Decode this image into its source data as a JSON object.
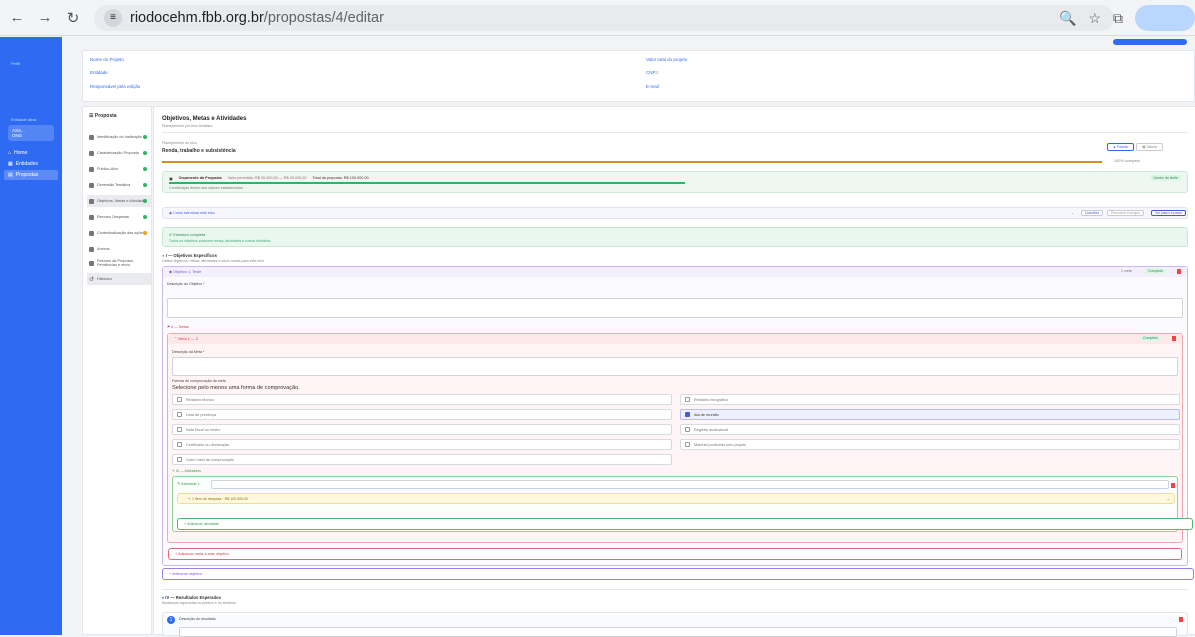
{
  "browser": {
    "url_host": "riodocehm.fbb.org.br",
    "url_path": "/propostas/4/editar"
  },
  "sidebar": {
    "section_label": "Perfil",
    "entity_label": "Entidade ativa",
    "entity_name": "ASS...",
    "entity_sub": "ONG",
    "items": [
      {
        "label": "Home"
      },
      {
        "label": "Entidades"
      },
      {
        "label": "Propostas"
      }
    ]
  },
  "info": {
    "nome_projeto": "Nome do Projeto",
    "entidade": "Entidade",
    "responsavel": "Responsável pela edição",
    "valor_total": "Valor total do projeto",
    "cnpj": "CNPJ",
    "email": "E-mail"
  },
  "steps": {
    "title": "Proposta",
    "items": [
      {
        "label": "Identificação do Instituição",
        "status": "complete"
      },
      {
        "label": "Caracterização Proposta",
        "status": "complete"
      },
      {
        "label": "Público-Alvo",
        "status": "complete"
      },
      {
        "label": "Dimensão Temática",
        "status": "complete"
      },
      {
        "label": "Objetivos, Metas e Atividades",
        "status": "complete"
      },
      {
        "label": "Resumo Despesas",
        "status": "complete"
      },
      {
        "label": "Contextualização das ações",
        "status": "partial"
      },
      {
        "label": "Anexos",
        "status": "none"
      },
      {
        "label": "Resumo da Proposta, Pendências e envio",
        "status": "none"
      },
      {
        "label": "Histórico",
        "status": "none"
      }
    ]
  },
  "main": {
    "title": "Objetivos, Metas e Atividades",
    "subtitle": "Planejamento por eixo temático",
    "eixo_label": "Planejamento do eixo",
    "eixo_title": "Renda, trabalho e subsistência",
    "view_toggle": {
      "primary": "Padrão",
      "secondary": "Tabela"
    },
    "progress_pct": 100,
    "progress_text": "100% completo",
    "orcamento": {
      "title": "Orçamento da Proposta",
      "range": "Valor permitido: R$ 00.000,00 — R$ 00.000,00",
      "total": "Total da proposta: R$ 100.000,00",
      "badge": "Dentro do limite",
      "note": "Contribuição dentro dos valores estabelecidos."
    },
    "estrutura": {
      "label": "Como estruturar este eixo",
      "btn1": "Questões",
      "btn2": "Preencher Exemplo",
      "btn3": "Ver passo a passo"
    },
    "status_box": {
      "title": "Estrutura completa",
      "text": "Todos os objetivos possuem metas, atividades e custos definidos."
    },
    "objetivos": {
      "header": "I — Objetivos Específicos",
      "sub": "Defina objetivos, metas, atividades e seus custos para este eixo",
      "objetivo": {
        "label": "Objetivo 1: Teste",
        "meta_count": "1 meta",
        "badge": "Completo",
        "desc_label": "Descrição do Objetivo *"
      }
    },
    "metas": {
      "header": "II — Metas",
      "meta_label": "Meta 1 — 3",
      "badge": "Completo",
      "desc_label": "Descrição da Meta *",
      "forma_label": "Formas de comprovação da meta",
      "forma_hint": "Selecione pelo menos uma forma de comprovação.",
      "options": [
        {
          "label": "Relatório técnico",
          "checked": false
        },
        {
          "label": "Relatório fotográfico",
          "checked": false
        },
        {
          "label": "Lista de presença",
          "checked": false
        },
        {
          "label": "Ata de reunião",
          "checked": true
        },
        {
          "label": "Nota fiscal ou recibo",
          "checked": false
        },
        {
          "label": "Registro audiovisual",
          "checked": false
        },
        {
          "label": "Certificado ou declaração",
          "checked": false
        },
        {
          "label": "Material produzido pelo projeto",
          "checked": false
        },
        {
          "label": "Outro meio de comprovação",
          "checked": false
        }
      ],
      "add_meta": "+ Adicionar meta a este objetivo"
    },
    "atividades": {
      "header": "III — Atividades",
      "atividade_label": "Atividade 1",
      "despesa": "1 item de despesa · R$ 100.000,00",
      "add_atividade": "+ Adicionar atividade"
    },
    "add_objetivo": "+ Adicionar objetivo",
    "resultados": {
      "header": "IV — Resultados Esperados",
      "sub": "Mudanças esperadas no público e no território",
      "desc_label": "Descrição do resultado"
    }
  },
  "colors": {
    "brand": "#2f6bf2",
    "progress": "#d98c1c",
    "success": "#2fb36b",
    "meta_bg": "#fde8ea",
    "atividade_border": "#58b46a",
    "objetivo_border": "#9a7de6"
  }
}
